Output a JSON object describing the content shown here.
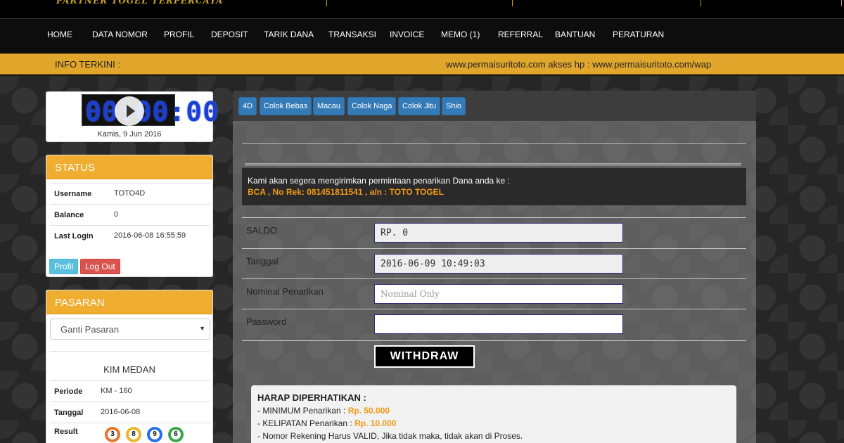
{
  "brand": {
    "tagline": "PARTNER TOGEL TERPERCAYA"
  },
  "nav": [
    "HOME",
    "DATA NOMOR",
    "PROFIL",
    "DEPOSIT",
    "TARIK DANA",
    "TRANSAKSI",
    "INVOICE",
    "MEMO (1)",
    "REFERRAL",
    "BANTUAN",
    "PERATURAN"
  ],
  "ticker": {
    "label": "INFO TERKINI :",
    "message": "www.permaisuritoto.com akses hp : www.permaisuritoto.com/wap"
  },
  "clock": {
    "digits": "00:00:00",
    "date": "Kamis, 9 Jun 2016"
  },
  "status": {
    "title": "STATUS",
    "rows": [
      {
        "key": "Username",
        "value": "TOTO4D"
      },
      {
        "key": "Balance",
        "value": "0"
      },
      {
        "key": "Last Login",
        "value": "2016-06-08 16:55:59"
      }
    ],
    "profil_label": "Profil",
    "logout_label": "Log Out"
  },
  "pasaran": {
    "title": "PASARAN",
    "select_value": "Ganti Pasaran",
    "market": "KIM MEDAN",
    "rows": [
      {
        "key": "Periode",
        "value": "KM - 160"
      },
      {
        "key": "Tanggal",
        "value": "2016-06-08"
      }
    ],
    "result_label": "Result",
    "result_numbers": [
      "3",
      "8",
      "9",
      "6"
    ],
    "ball_colors": [
      "#e8752a",
      "#e8b82a",
      "#2a6fe8",
      "#3aa84a"
    ]
  },
  "tabs": [
    "4D",
    "Colok Bebas",
    "Macau",
    "Colok Naga",
    "Colok Jitu",
    "Shio"
  ],
  "notice": {
    "line1": "Kami akan segera mengirimkan permintaan penarikan Dana anda ke :",
    "account": "BCA , No Rek: 081451811541 , a/n : TOTO TOGEL"
  },
  "form": {
    "saldo_label": "SALDO",
    "saldo_value": "RP. 0",
    "tanggal_label": "Tanggal",
    "tanggal_value": "2016-06-09 10:49:03",
    "nominal_label": "Nominal Penarikan",
    "nominal_placeholder": "Nominal Only",
    "password_label": "Password",
    "password_value": "",
    "withdraw_label": "WITHDRAW"
  },
  "info": {
    "title": "HARAP DIPERHATIKAN :",
    "min_label": "- MINIMUM Penarikan : ",
    "min_value": "Rp. 50.000",
    "kel_label": "- KELIPATAN Penarikan : ",
    "kel_value": "Rp. 10.000",
    "rek_note": "- Nomor Rekening Harus VALID, Jika tidak maka, tidak akan di Proses."
  }
}
